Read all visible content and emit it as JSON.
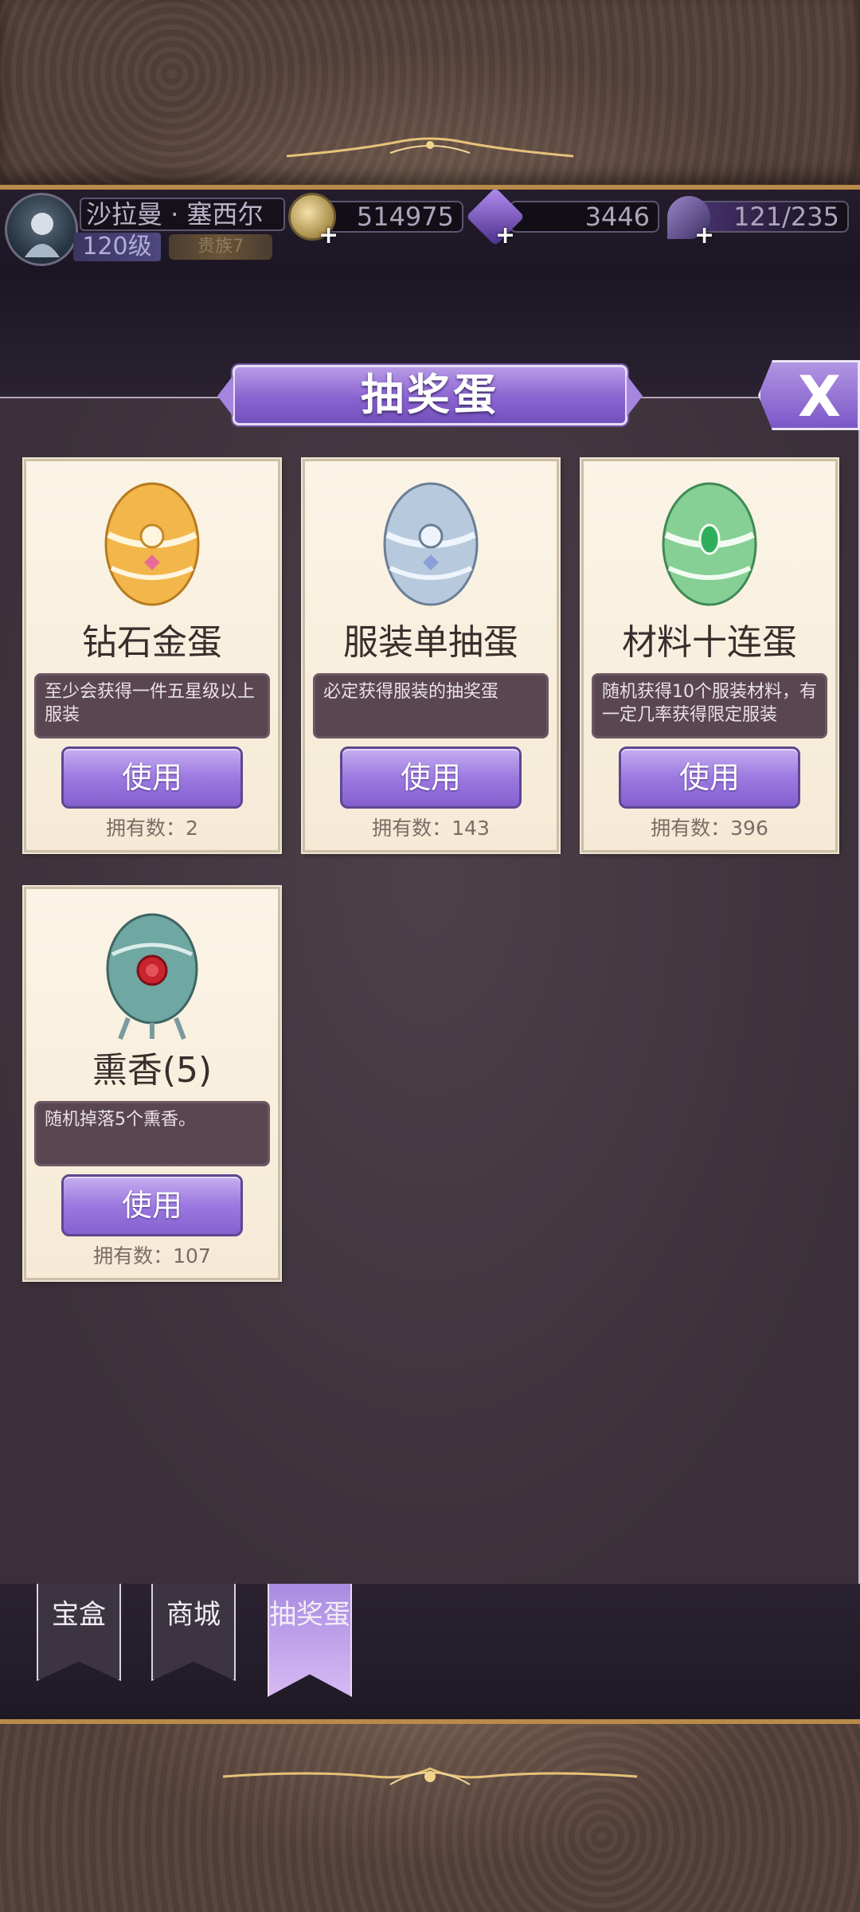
{
  "player": {
    "name": "沙拉曼 · 塞西尔",
    "level": "120级",
    "rank": "贵族7"
  },
  "resources": {
    "gold": "514975",
    "diamonds": "3446",
    "energy": "121/235",
    "plus_symbol": "+"
  },
  "panel": {
    "title": "抽奖蛋",
    "close_label": "X"
  },
  "items": [
    {
      "name": "钻石金蛋",
      "description": "至少会获得一件五星级以上服装",
      "button": "使用",
      "owned": "拥有数：2",
      "egg_color": "#f2b848"
    },
    {
      "name": "服装单抽蛋",
      "description": "必定获得服装的抽奖蛋",
      "button": "使用",
      "owned": "拥有数：143",
      "egg_color": "#a9c6e0"
    },
    {
      "name": "材料十连蛋",
      "description": "随机获得10个服装材料，有一定几率获得限定服装",
      "button": "使用",
      "owned": "拥有数：396",
      "egg_color": "#7fcf8e"
    },
    {
      "name": "熏香(5)",
      "description": "随机掉落5个熏香。",
      "button": "使用",
      "owned": "拥有数：107",
      "egg_color": "#5f9c98"
    }
  ],
  "tabs": [
    {
      "label": "宝盒",
      "active": false
    },
    {
      "label": "商城",
      "active": false
    },
    {
      "label": "抽奖蛋",
      "active": true
    }
  ],
  "colors": {
    "accent_purple": "#9c79e0",
    "card_bg": "#fbf4e6",
    "panel_bg": "#3b3039",
    "frame_gold": "#b98a4a"
  },
  "icons": [
    "avatar-portrait",
    "gold-coin-icon",
    "diamond-icon",
    "energy-icon",
    "close-icon",
    "egg-icon"
  ]
}
